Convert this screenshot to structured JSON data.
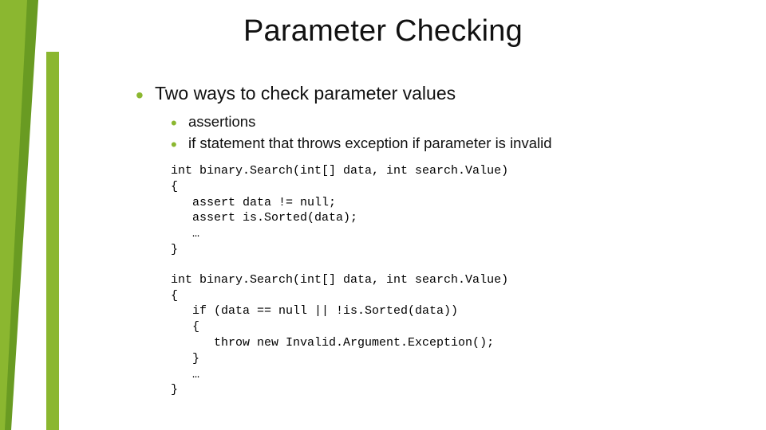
{
  "colors": {
    "accent": "#8BB730"
  },
  "title": "Parameter Checking",
  "main_bullet": "Two ways to check parameter values",
  "sub_bullets": [
    "assertions",
    "if statement that throws exception if parameter is invalid"
  ],
  "code1": "int binary.Search(int[] data, int search.Value)\n{\n   assert data != null;\n   assert is.Sorted(data);\n   …\n}",
  "code2": "int binary.Search(int[] data, int search.Value)\n{\n   if (data == null || !is.Sorted(data))\n   {\n      throw new Invalid.Argument.Exception();\n   }\n   …\n}"
}
